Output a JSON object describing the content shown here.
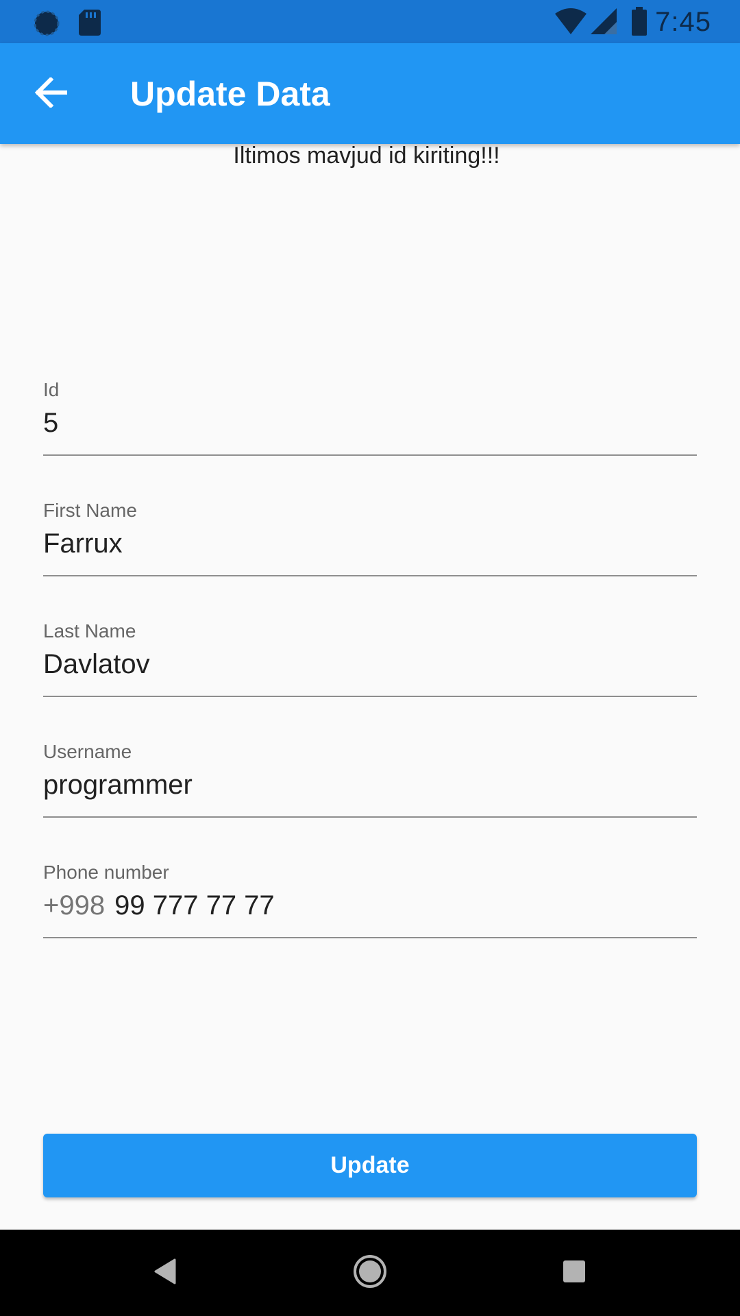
{
  "status_bar": {
    "time": "7:45",
    "icons": [
      "data-saver-icon",
      "sd-card-icon",
      "wifi-icon",
      "cell-signal-icon",
      "battery-icon"
    ]
  },
  "app_bar": {
    "title": "Update Data",
    "back_icon": "arrow-back-icon",
    "color": "#2196f3"
  },
  "hint": "Iltimos mavjud id kiriting!!!",
  "fields": {
    "id": {
      "label": "Id",
      "value": "5"
    },
    "first_name": {
      "label": "First Name",
      "value": "Farrux"
    },
    "last_name": {
      "label": "Last Name",
      "value": "Davlatov"
    },
    "username": {
      "label": "Username",
      "value": "programmer"
    },
    "phone": {
      "label": "Phone number",
      "prefix": "+998",
      "value": "99 777 77 77"
    }
  },
  "update_button": {
    "label": "Update",
    "color": "#2196f3"
  },
  "nav_bar": {
    "icons": [
      "back-triangle-icon",
      "home-circle-icon",
      "recents-square-icon"
    ]
  }
}
